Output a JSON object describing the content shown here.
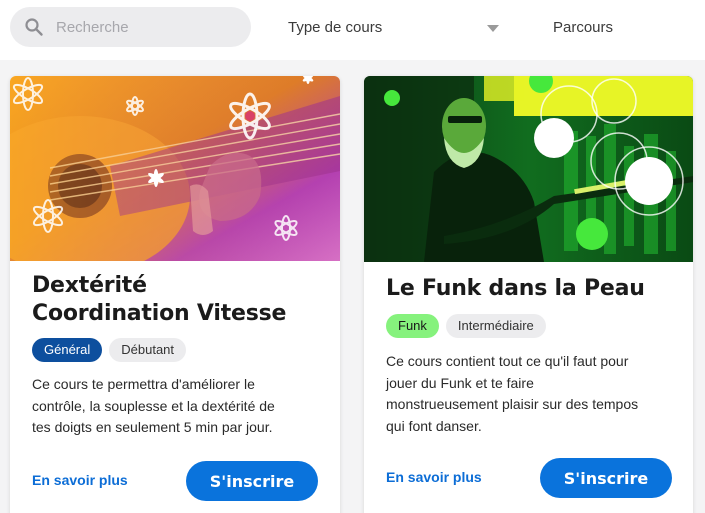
{
  "search": {
    "placeholder": "Recherche",
    "value": ""
  },
  "filters": {
    "course_type_label": "Type de cours",
    "parcours_label": "Parcours"
  },
  "courses": [
    {
      "title_line1": "Dextérité",
      "title_line2": "Coordination Vitesse",
      "tags": [
        "Général",
        "Débutant"
      ],
      "description_lines": [
        "Ce cours te permettra d'améliorer le",
        "contrôle, la souplesse et la dextérité de",
        "tes doigts en seulement 5 min par jour."
      ],
      "more_label": "En savoir plus",
      "signup_label": "S'inscrire",
      "image": "guitar-hands-photo"
    },
    {
      "title": "Le Funk dans la Peau",
      "tags": [
        "Funk",
        "Intermédiaire"
      ],
      "description_lines": [
        "Ce cours contient tout ce qu'il faut pour",
        "jouer du Funk et te faire",
        "monstrueusement plaisir sur des tempos",
        "qui font danser."
      ],
      "more_label": "En savoir plus",
      "signup_label": "S'inscrire",
      "image": "bearded-guitarist-photo"
    }
  ],
  "colors": {
    "accent": "#0a73dc",
    "tag_general": "#0d4f9e",
    "tag_funk": "#86f27d"
  }
}
